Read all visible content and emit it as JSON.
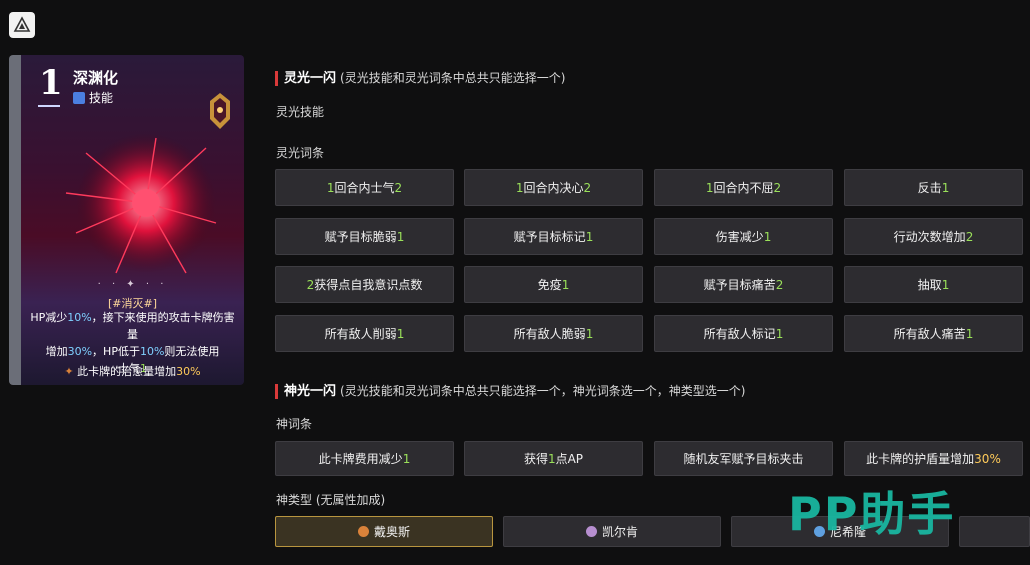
{
  "card": {
    "number": "1",
    "name": "深渊化",
    "type_label": "技能",
    "stars": "· · ✦ · ·",
    "tag": "[#消灭#]",
    "desc_line1_a": "HP减少",
    "desc_line1_b": "10%",
    "desc_line1_c": "，接下来使用的攻击卡牌伤害量",
    "desc_line2_a": "增加",
    "desc_line2_b": "30%",
    "desc_line2_c": "，HP低于",
    "desc_line2_d": "10%",
    "desc_line2_e": "则无法使用",
    "desc_line3_a": "士气",
    "desc_line3_b": "1",
    "bonus_a": "此卡牌的治愈量增加",
    "bonus_b": "30%"
  },
  "flash": {
    "title": "灵光一闪",
    "note": "(灵光技能和灵光词条中总共只能选择一个)",
    "skill_label": "灵光技能",
    "affix_label": "灵光词条",
    "buttons": [
      {
        "pre": "",
        "num": "1",
        "post": "回合内士气",
        "num2": "2"
      },
      {
        "pre": "",
        "num": "1",
        "post": "回合内决心",
        "num2": "2"
      },
      {
        "pre": "",
        "num": "1",
        "post": "回合内不屈",
        "num2": "2"
      },
      {
        "pre": "反击",
        "num": "",
        "post": "",
        "num2": "1"
      },
      {
        "pre": "赋予目标脆弱",
        "num": "",
        "post": "",
        "num2": "1"
      },
      {
        "pre": "赋予目标标记",
        "num": "",
        "post": "",
        "num2": "1"
      },
      {
        "pre": "伤害减少",
        "num": "",
        "post": "",
        "num2": "1"
      },
      {
        "pre": "行动次数增加",
        "num": "",
        "post": "",
        "num2": "2"
      },
      {
        "pre": "获得",
        "num": "2",
        "post": "点自我意识点数",
        "num2": ""
      },
      {
        "pre": "免疫",
        "num": "",
        "post": "",
        "num2": "1"
      },
      {
        "pre": "赋予目标痛苦",
        "num": "",
        "post": "",
        "num2": "2"
      },
      {
        "pre": "抽取",
        "num": "",
        "post": "",
        "num2": "1"
      },
      {
        "pre": "所有敌人削弱",
        "num": "",
        "post": "",
        "num2": "1"
      },
      {
        "pre": "所有敌人脆弱",
        "num": "",
        "post": "",
        "num2": "1"
      },
      {
        "pre": "所有敌人标记",
        "num": "",
        "post": "",
        "num2": "1"
      },
      {
        "pre": "所有敌人痛苦",
        "num": "",
        "post": "",
        "num2": "1"
      }
    ]
  },
  "god": {
    "title": "神光一闪",
    "note": "(灵光技能和灵光词条中总共只能选择一个，神光词条选一个，神类型选一个)",
    "affix_label": "神词条",
    "type_label": "神类型 (无属性加成)",
    "affixes": [
      {
        "pre": "此卡牌费用减少",
        "num": "1",
        "post": ""
      },
      {
        "pre": "获得",
        "num": "1",
        "post": "点AP"
      },
      {
        "pre": "随机友军赋予目标夹击",
        "num": "",
        "post": ""
      },
      {
        "pre": "此卡牌的护盾量增加",
        "num": "30%",
        "post": ""
      }
    ],
    "types": [
      {
        "label": "戴奥斯",
        "icon_color": "#d9823a",
        "selected": true
      },
      {
        "label": "凯尔肯",
        "icon_color": "#b78fd0",
        "selected": false
      },
      {
        "label": "尼希隆",
        "icon_color": "#5fa0e0",
        "selected": false
      }
    ]
  },
  "watermark": "PP助手"
}
